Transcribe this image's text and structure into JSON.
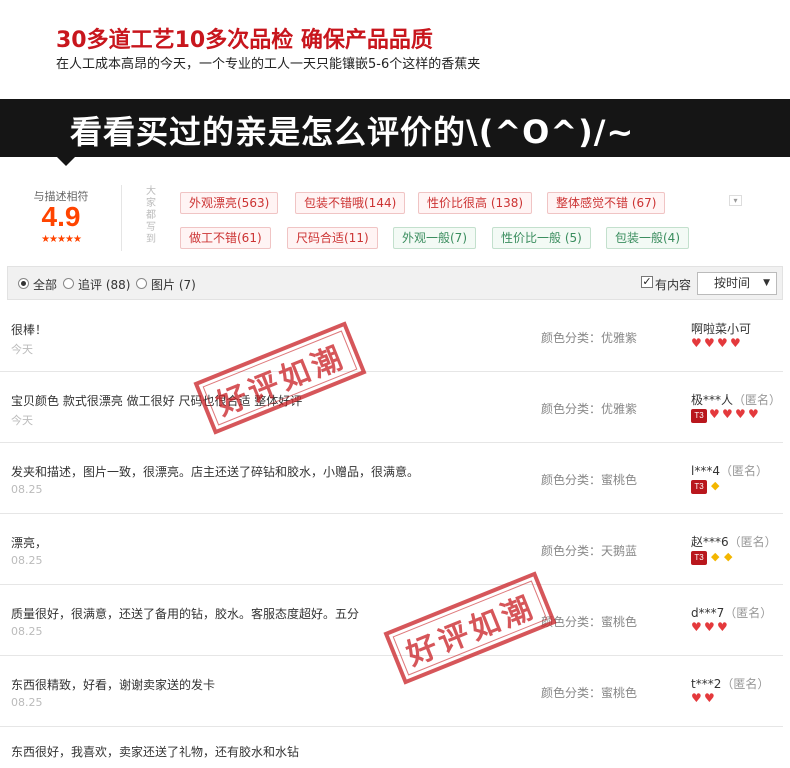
{
  "header": {
    "title": "30多道工艺10多次品检 确保产品品质",
    "subtitle": "在人工成本高昂的今天，一个专业的工人一天只能镶嵌5-6个这样的香蕉夹"
  },
  "banner": {
    "text": "看看买过的亲是怎么评价的\\(^O^)/~"
  },
  "rating": {
    "label": "与描述相符",
    "score": "4.9",
    "stars": "★★★★★",
    "side_note": "大家都写到"
  },
  "tags": [
    {
      "label": "外观漂亮(563)",
      "kind": "pos"
    },
    {
      "label": "包装不错哦(144)",
      "kind": "pos"
    },
    {
      "label": "性价比很高 (138)",
      "kind": "pos"
    },
    {
      "label": "整体感觉不错 (67)",
      "kind": "pos"
    },
    {
      "label": "做工不错(61)",
      "kind": "pos"
    },
    {
      "label": "尺码合适(11)",
      "kind": "pos"
    },
    {
      "label": "外观一般(7)",
      "kind": "neu"
    },
    {
      "label": "性价比一般 (5)",
      "kind": "neu"
    },
    {
      "label": "包装一般(4)",
      "kind": "neu"
    }
  ],
  "filter": {
    "all": "全部",
    "followup": "追评 (88)",
    "pictures": "图片 (7)",
    "has_content": "有内容",
    "sort": "按时间"
  },
  "sku_label": "颜色分类：",
  "reviews": [
    {
      "content": "很棒！",
      "date": "今天",
      "sku": "优雅紫",
      "user": "啊啦菜小可",
      "anon": "",
      "t3": false,
      "hearts": 4,
      "diamonds": 0
    },
    {
      "content": "宝贝颜色 款式很漂亮 做工很好 尺码也很合适 整体好评",
      "date": "今天",
      "sku": "优雅紫",
      "user": "极***人",
      "anon": "（匿名）",
      "t3": true,
      "hearts": 4,
      "diamonds": 0
    },
    {
      "content": "发夹和描述，图片一致，很漂亮。店主还送了碎钻和胶水，小赠品，很满意。",
      "date": "08.25",
      "sku": "蜜桃色",
      "user": "l***4",
      "anon": "（匿名）",
      "t3": true,
      "hearts": 0,
      "diamonds": 1
    },
    {
      "content": "漂亮，",
      "date": "08.25",
      "sku": "天鹅蓝",
      "user": "赵***6",
      "anon": "（匿名）",
      "t3": true,
      "hearts": 0,
      "diamonds": 2
    },
    {
      "content": "质量很好，很满意，还送了备用的钻，胶水。客服态度超好。五分",
      "date": "08.25",
      "sku": "蜜桃色",
      "user": "d***7",
      "anon": "（匿名）",
      "t3": false,
      "hearts": 3,
      "diamonds": 0
    },
    {
      "content": "东西很精致，好看，谢谢卖家送的发卡",
      "date": "08.25",
      "sku": "蜜桃色",
      "user": "t***2",
      "anon": "（匿名）",
      "t3": false,
      "hearts": 2,
      "diamonds": 0
    }
  ],
  "last_review": {
    "content": "东西很好，我喜欢，卖家还送了礼物，还有胶水和水钻"
  },
  "stamps": [
    "好评如潮",
    "好评如潮"
  ]
}
